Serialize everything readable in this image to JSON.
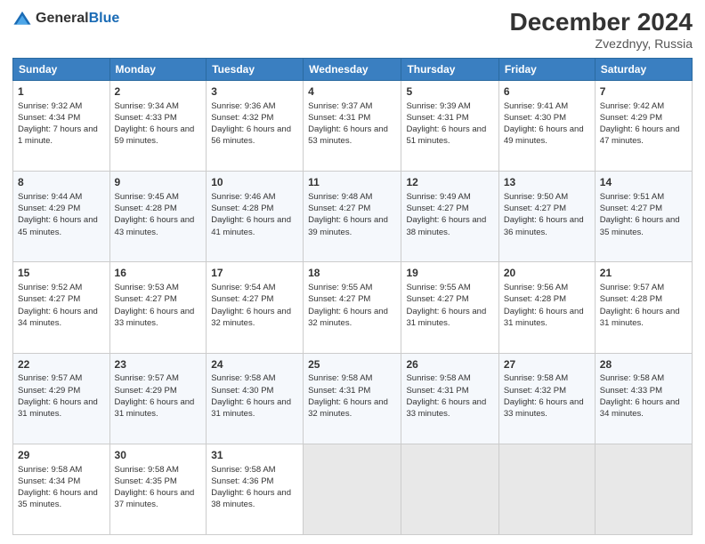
{
  "logo": {
    "general": "General",
    "blue": "Blue"
  },
  "title": "December 2024",
  "location": "Zvezdnyy, Russia",
  "headers": [
    "Sunday",
    "Monday",
    "Tuesday",
    "Wednesday",
    "Thursday",
    "Friday",
    "Saturday"
  ],
  "weeks": [
    [
      {
        "day": "1",
        "sunrise": "9:32 AM",
        "sunset": "4:34 PM",
        "daylight": "7 hours and 1 minute."
      },
      {
        "day": "2",
        "sunrise": "9:34 AM",
        "sunset": "4:33 PM",
        "daylight": "6 hours and 59 minutes."
      },
      {
        "day": "3",
        "sunrise": "9:36 AM",
        "sunset": "4:32 PM",
        "daylight": "6 hours and 56 minutes."
      },
      {
        "day": "4",
        "sunrise": "9:37 AM",
        "sunset": "4:31 PM",
        "daylight": "6 hours and 53 minutes."
      },
      {
        "day": "5",
        "sunrise": "9:39 AM",
        "sunset": "4:31 PM",
        "daylight": "6 hours and 51 minutes."
      },
      {
        "day": "6",
        "sunrise": "9:41 AM",
        "sunset": "4:30 PM",
        "daylight": "6 hours and 49 minutes."
      },
      {
        "day": "7",
        "sunrise": "9:42 AM",
        "sunset": "4:29 PM",
        "daylight": "6 hours and 47 minutes."
      }
    ],
    [
      {
        "day": "8",
        "sunrise": "9:44 AM",
        "sunset": "4:29 PM",
        "daylight": "6 hours and 45 minutes."
      },
      {
        "day": "9",
        "sunrise": "9:45 AM",
        "sunset": "4:28 PM",
        "daylight": "6 hours and 43 minutes."
      },
      {
        "day": "10",
        "sunrise": "9:46 AM",
        "sunset": "4:28 PM",
        "daylight": "6 hours and 41 minutes."
      },
      {
        "day": "11",
        "sunrise": "9:48 AM",
        "sunset": "4:27 PM",
        "daylight": "6 hours and 39 minutes."
      },
      {
        "day": "12",
        "sunrise": "9:49 AM",
        "sunset": "4:27 PM",
        "daylight": "6 hours and 38 minutes."
      },
      {
        "day": "13",
        "sunrise": "9:50 AM",
        "sunset": "4:27 PM",
        "daylight": "6 hours and 36 minutes."
      },
      {
        "day": "14",
        "sunrise": "9:51 AM",
        "sunset": "4:27 PM",
        "daylight": "6 hours and 35 minutes."
      }
    ],
    [
      {
        "day": "15",
        "sunrise": "9:52 AM",
        "sunset": "4:27 PM",
        "daylight": "6 hours and 34 minutes."
      },
      {
        "day": "16",
        "sunrise": "9:53 AM",
        "sunset": "4:27 PM",
        "daylight": "6 hours and 33 minutes."
      },
      {
        "day": "17",
        "sunrise": "9:54 AM",
        "sunset": "4:27 PM",
        "daylight": "6 hours and 32 minutes."
      },
      {
        "day": "18",
        "sunrise": "9:55 AM",
        "sunset": "4:27 PM",
        "daylight": "6 hours and 32 minutes."
      },
      {
        "day": "19",
        "sunrise": "9:55 AM",
        "sunset": "4:27 PM",
        "daylight": "6 hours and 31 minutes."
      },
      {
        "day": "20",
        "sunrise": "9:56 AM",
        "sunset": "4:28 PM",
        "daylight": "6 hours and 31 minutes."
      },
      {
        "day": "21",
        "sunrise": "9:57 AM",
        "sunset": "4:28 PM",
        "daylight": "6 hours and 31 minutes."
      }
    ],
    [
      {
        "day": "22",
        "sunrise": "9:57 AM",
        "sunset": "4:29 PM",
        "daylight": "6 hours and 31 minutes."
      },
      {
        "day": "23",
        "sunrise": "9:57 AM",
        "sunset": "4:29 PM",
        "daylight": "6 hours and 31 minutes."
      },
      {
        "day": "24",
        "sunrise": "9:58 AM",
        "sunset": "4:30 PM",
        "daylight": "6 hours and 31 minutes."
      },
      {
        "day": "25",
        "sunrise": "9:58 AM",
        "sunset": "4:31 PM",
        "daylight": "6 hours and 32 minutes."
      },
      {
        "day": "26",
        "sunrise": "9:58 AM",
        "sunset": "4:31 PM",
        "daylight": "6 hours and 33 minutes."
      },
      {
        "day": "27",
        "sunrise": "9:58 AM",
        "sunset": "4:32 PM",
        "daylight": "6 hours and 33 minutes."
      },
      {
        "day": "28",
        "sunrise": "9:58 AM",
        "sunset": "4:33 PM",
        "daylight": "6 hours and 34 minutes."
      }
    ],
    [
      {
        "day": "29",
        "sunrise": "9:58 AM",
        "sunset": "4:34 PM",
        "daylight": "6 hours and 35 minutes."
      },
      {
        "day": "30",
        "sunrise": "9:58 AM",
        "sunset": "4:35 PM",
        "daylight": "6 hours and 37 minutes."
      },
      {
        "day": "31",
        "sunrise": "9:58 AM",
        "sunset": "4:36 PM",
        "daylight": "6 hours and 38 minutes."
      },
      null,
      null,
      null,
      null
    ]
  ],
  "labels": {
    "sunrise": "Sunrise:",
    "sunset": "Sunset:",
    "daylight": "Daylight:"
  }
}
